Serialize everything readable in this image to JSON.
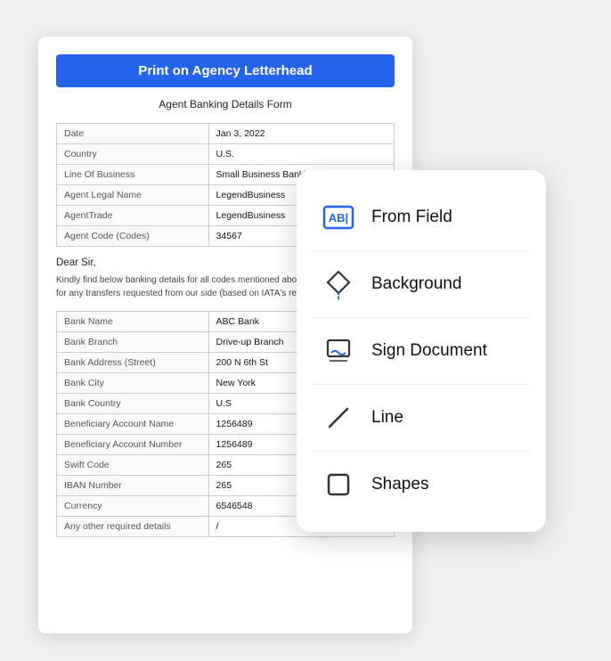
{
  "document": {
    "title": "Print on Agency Letterhead",
    "subtitle": "Agent Banking Details Form",
    "fields1": [
      {
        "label": "Date",
        "value": "Jan 3, 2022"
      },
      {
        "label": "Country",
        "value": "U.S."
      },
      {
        "label": "Line Of Business",
        "value": "Small Business Banking"
      },
      {
        "label": "Agent Legal Name",
        "value": "LegendBusiness"
      },
      {
        "label": "AgentTrade",
        "value": "LegendBusiness"
      },
      {
        "label": "Agent Code (Codes)",
        "value": "34567"
      }
    ],
    "dear": "Dear Sir,",
    "body": "Kindly find below banking details for all codes mentioned above. Those banking det... for any transfers requested from our side (based on IATA's records) effective from d...",
    "fields2": [
      {
        "label": "Bank Name",
        "value": "ABC Bank"
      },
      {
        "label": "Bank Branch",
        "value": "Drive-up Branch"
      },
      {
        "label": "Bank Address (Street)",
        "value": "200 N 6th St"
      },
      {
        "label": "Bank City",
        "value": "New York"
      },
      {
        "label": "Bank Country",
        "value": "U.S"
      },
      {
        "label": "Beneficiary Account Name",
        "value": "1256489"
      },
      {
        "label": "Beneficiary Account Number",
        "value": "1256489"
      },
      {
        "label": "Swift Code",
        "value": "265"
      },
      {
        "label": "IBAN Number",
        "value": "265"
      },
      {
        "label": "Currency",
        "value": "6546548"
      },
      {
        "label": "Any other required details",
        "value": "/"
      }
    ]
  },
  "menu": {
    "items": [
      {
        "id": "from-field",
        "label": "From Field"
      },
      {
        "id": "background",
        "label": "Background"
      },
      {
        "id": "sign-document",
        "label": "Sign Document"
      },
      {
        "id": "line",
        "label": "Line"
      },
      {
        "id": "shapes",
        "label": "Shapes"
      }
    ]
  }
}
